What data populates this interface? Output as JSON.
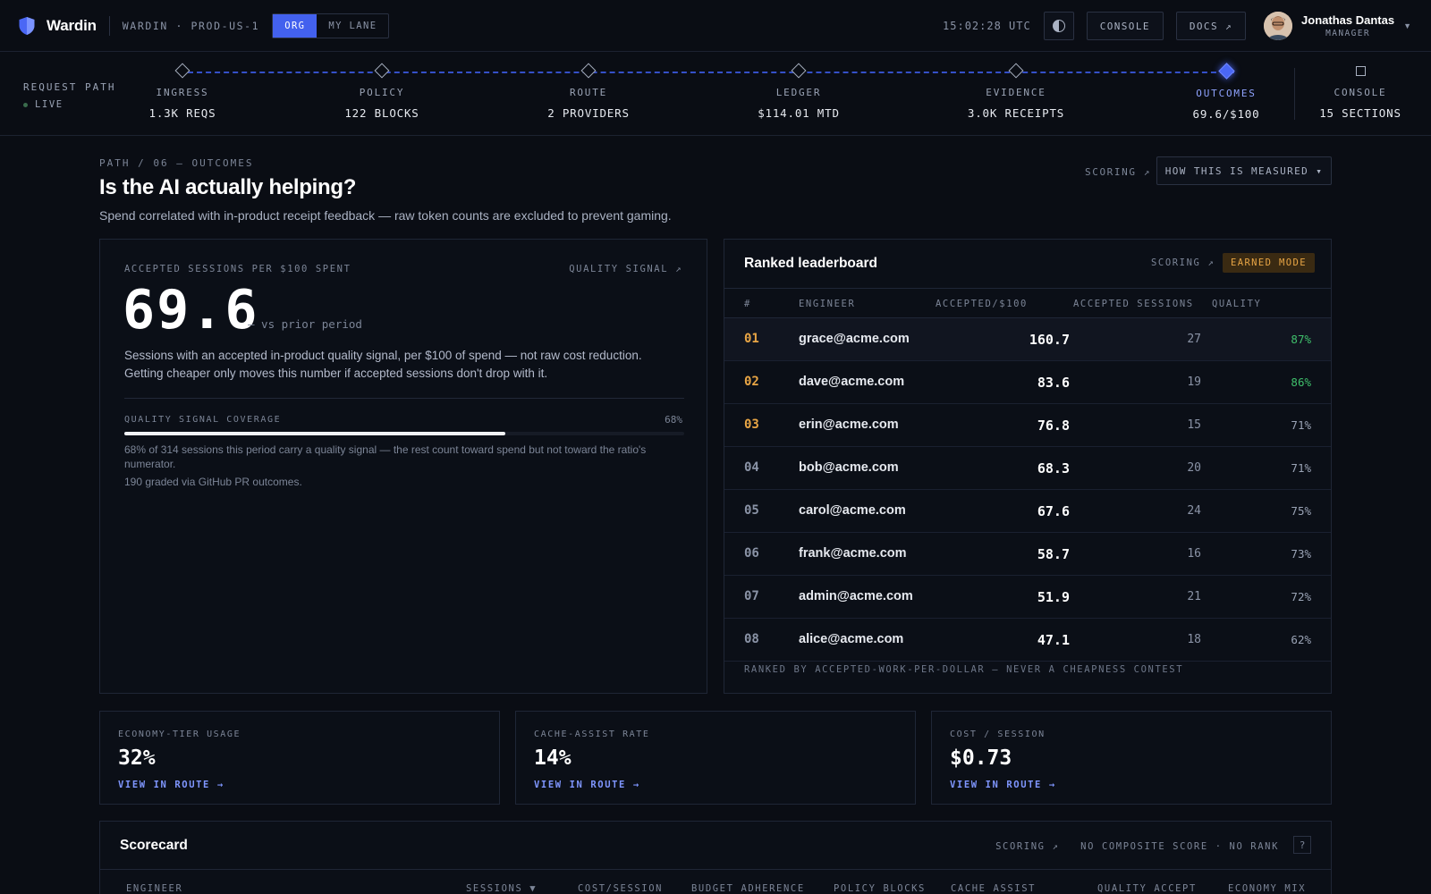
{
  "app": {
    "name": "Wardin",
    "env": "WARDIN · PROD-US-1",
    "scope_tabs": [
      "ORG",
      "MY LANE"
    ],
    "active_scope": "ORG"
  },
  "topbar": {
    "clock": "15:02:28 UTC",
    "theme_icon": "contrast-icon",
    "console_label": "CONSOLE",
    "docs_label": "DOCS ↗",
    "user_name": "Jonathas Dantas",
    "user_role": "MANAGER"
  },
  "request_path": {
    "label": "REQUEST PATH",
    "status": "LIVE",
    "steps": [
      {
        "name": "INGRESS",
        "value": "1.3K REQS"
      },
      {
        "name": "POLICY",
        "value": "122 BLOCKS"
      },
      {
        "name": "ROUTE",
        "value": "2 PROVIDERS"
      },
      {
        "name": "LEDGER",
        "value": "$114.01 MTD"
      },
      {
        "name": "EVIDENCE",
        "value": "3.0K RECEIPTS"
      },
      {
        "name": "OUTCOMES",
        "value": "69.6/$100"
      },
      {
        "name": "CONSOLE",
        "value": "15 SECTIONS"
      }
    ],
    "active_step": "OUTCOMES"
  },
  "page": {
    "breadcrumb": "PATH / 06 — OUTCOMES",
    "title": "Is the AI actually helping?",
    "subtitle": "Spend correlated with in-product receipt feedback — raw token counts are excluded to prevent gaming.",
    "scoring_link": "SCORING ↗",
    "how_button": "HOW THIS IS MEASURED ▾"
  },
  "kpi": {
    "label": "ACCEPTED SESSIONS PER $100 SPENT",
    "link": "QUALITY SIGNAL ↗",
    "value": "69.6",
    "comparison": "— vs prior period",
    "description": "Sessions with an accepted in-product quality signal, per $100 of spend — not raw cost reduction. Getting cheaper only moves this number if accepted sessions don't drop with it.",
    "coverage_label": "QUALITY SIGNAL COVERAGE",
    "coverage_pct_text": "68%",
    "coverage_fraction": 0.68,
    "coverage_note": "68% of 314 sessions this period carry a quality signal — the rest count toward spend but not toward the ratio's numerator.",
    "graded_note": "190 graded via GitHub PR outcomes."
  },
  "leaderboard": {
    "title": "Ranked leaderboard",
    "scoring_link": "SCORING ↗",
    "mode_badge": "EARNED MODE",
    "columns": [
      "#",
      "ENGINEER",
      "ACCEPTED/$100",
      "ACCEPTED SESSIONS",
      "QUALITY"
    ],
    "rows": [
      {
        "rank": "01",
        "engineer": "grace@acme.com",
        "accepted_per_100": "160.7",
        "sessions": "27",
        "quality": "87%"
      },
      {
        "rank": "02",
        "engineer": "dave@acme.com",
        "accepted_per_100": "83.6",
        "sessions": "19",
        "quality": "86%"
      },
      {
        "rank": "03",
        "engineer": "erin@acme.com",
        "accepted_per_100": "76.8",
        "sessions": "15",
        "quality": "71%"
      },
      {
        "rank": "04",
        "engineer": "bob@acme.com",
        "accepted_per_100": "68.3",
        "sessions": "20",
        "quality": "71%"
      },
      {
        "rank": "05",
        "engineer": "carol@acme.com",
        "accepted_per_100": "67.6",
        "sessions": "24",
        "quality": "75%"
      },
      {
        "rank": "06",
        "engineer": "frank@acme.com",
        "accepted_per_100": "58.7",
        "sessions": "16",
        "quality": "73%"
      },
      {
        "rank": "07",
        "engineer": "admin@acme.com",
        "accepted_per_100": "51.9",
        "sessions": "21",
        "quality": "72%"
      },
      {
        "rank": "08",
        "engineer": "alice@acme.com",
        "accepted_per_100": "47.1",
        "sessions": "18",
        "quality": "62%"
      }
    ],
    "footer": "RANKED BY ACCEPTED-WORK-PER-DOLLAR — NEVER A CHEAPNESS CONTEST",
    "colors": {
      "top_rank": "#e8a545",
      "high_quality": "#3fbf6b"
    }
  },
  "cards": [
    {
      "label": "ECONOMY-TIER USAGE",
      "value": "32%",
      "link": "VIEW IN ROUTE →"
    },
    {
      "label": "CACHE-ASSIST RATE",
      "value": "14%",
      "link": "VIEW IN ROUTE →"
    },
    {
      "label": "COST / SESSION",
      "value": "$0.73",
      "link": "VIEW IN ROUTE →"
    }
  ],
  "scorecard": {
    "title": "Scorecard",
    "meta": "SCORING ↗   NO COMPOSITE SCORE · NO RANK",
    "help": "?",
    "columns": [
      "ENGINEER",
      "SESSIONS ▼",
      "COST/SESSION",
      "BUDGET ADHERENCE",
      "POLICY BLOCKS",
      "CACHE ASSIST",
      "QUALITY ACCEPT",
      "ECONOMY MIX"
    ]
  },
  "colors": {
    "accent": "#4361ee",
    "background": "#0a0d14"
  }
}
